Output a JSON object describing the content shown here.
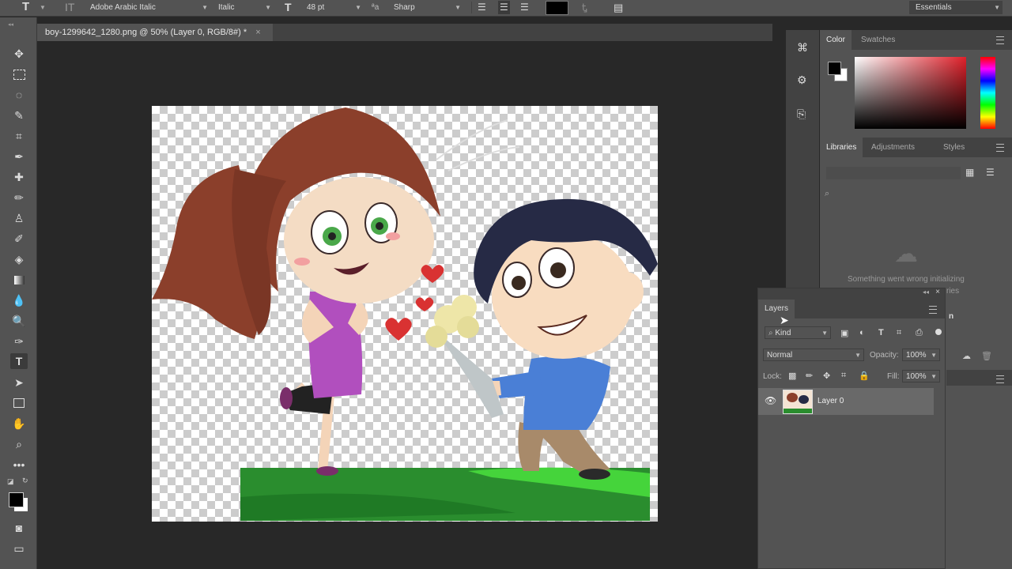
{
  "options_bar": {
    "tool_icon": "type-tool-icon",
    "font_family": "Adobe Arabic Italic",
    "font_style": "Italic",
    "font_size": "48 pt",
    "antialias": "Sharp",
    "text_color": "#000000",
    "workspace": "Essentials"
  },
  "document": {
    "tab_title": "boy-1299642_1280.png @ 50% (Layer 0, RGB/8#) *",
    "close": "×"
  },
  "color_panel": {
    "tabs": [
      "Color",
      "Swatches"
    ],
    "foreground": "#000000",
    "background": "#ffffff"
  },
  "libraries_panel": {
    "tabs": [
      "Libraries",
      "Adjustments",
      "Styles"
    ],
    "message_line1": "Something went wrong initializing",
    "message_line2": "ries",
    "message_partial": "n"
  },
  "layers_panel": {
    "title": "Layers",
    "filter_kind": "Kind",
    "blend_mode": "Normal",
    "opacity_label": "Opacity:",
    "opacity_value": "100%",
    "lock_label": "Lock:",
    "fill_label": "Fill:",
    "fill_value": "100%",
    "layers": [
      {
        "name": "Layer 0",
        "visible": true
      }
    ]
  }
}
